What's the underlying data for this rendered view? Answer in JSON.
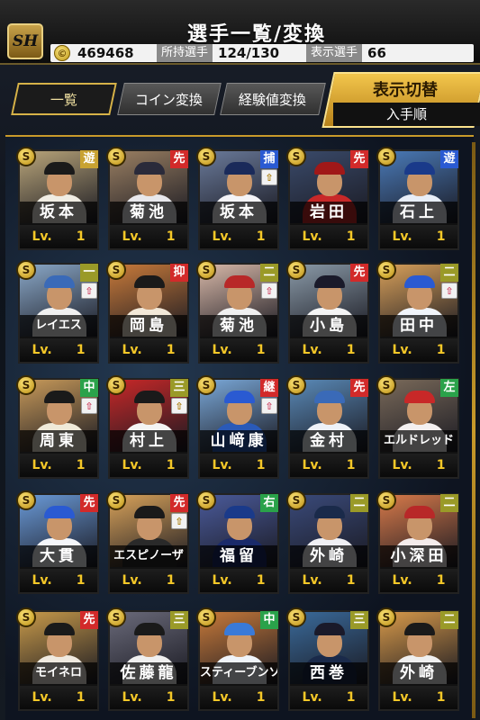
{
  "header": {
    "logo": "SH",
    "title": "選手一覧/変換",
    "coins": "469468",
    "owned_label": "所持選手",
    "owned_value": "124/130",
    "shown_label": "表示選手",
    "shown_value": "66"
  },
  "tabs": [
    {
      "label": "一覧"
    },
    {
      "label": "コイン変換"
    },
    {
      "label": "経験値変換"
    }
  ],
  "sort": {
    "title": "表示切替",
    "value": "入手順"
  },
  "level_label": "Lv.",
  "cards": [
    {
      "name": "坂本",
      "lv": "1",
      "pos": "遊",
      "pos_color": "gold",
      "up": false,
      "cap": "#1a1a1a",
      "uniform": "#f0ede4",
      "bg": "#b9a57a"
    },
    {
      "name": "菊池",
      "lv": "1",
      "pos": "先",
      "pos_color": "red",
      "up": false,
      "cap": "#2a2a3a",
      "uniform": "#e8e8ec",
      "bg": "#9a7f62"
    },
    {
      "name": "坂本",
      "lv": "1",
      "pos": "捕",
      "pos_color": "blue",
      "up": true,
      "cap": "#1a2a5a",
      "uniform": "#f4f4f8",
      "bg": "#6a7a9a"
    },
    {
      "name": "岩田",
      "lv": "1",
      "pos": "先",
      "pos_color": "red",
      "up": false,
      "cap": "#a01818",
      "uniform": "#c82828",
      "bg": "#3a4a6a"
    },
    {
      "name": "石上",
      "lv": "1",
      "pos": "遊",
      "pos_color": "blue",
      "up": false,
      "cap": "#1a3a8a",
      "uniform": "#e8eef8",
      "bg": "#4a7ab8"
    },
    {
      "name": "レイエス",
      "lv": "1",
      "pos": "一",
      "pos_color": "olive",
      "up": true,
      "up_pink": true,
      "cap": "#3a6ab8",
      "uniform": "#f0f0f0",
      "bg": "#8aa8c8",
      "tight": true
    },
    {
      "name": "岡島",
      "lv": "1",
      "pos": "抑",
      "pos_color": "red",
      "up": false,
      "cap": "#1a1a1a",
      "uniform": "#f2e8d8",
      "bg": "#c87a3a"
    },
    {
      "name": "菊池",
      "lv": "1",
      "pos": "二",
      "pos_color": "olive",
      "up": true,
      "up_pink": true,
      "cap": "#b82828",
      "uniform": "#f0f0f0",
      "bg": "#d8b8a8"
    },
    {
      "name": "小島",
      "lv": "1",
      "pos": "先",
      "pos_color": "red",
      "up": false,
      "cap": "#1a1a2a",
      "uniform": "#f4f4f4",
      "bg": "#8a9aa8"
    },
    {
      "name": "田中",
      "lv": "1",
      "pos": "二",
      "pos_color": "olive",
      "up": true,
      "up_pink": true,
      "cap": "#2a5ad2",
      "uniform": "#f0f4fa",
      "bg": "#d8a05a"
    },
    {
      "name": "周東",
      "lv": "1",
      "pos": "中",
      "pos_color": "green",
      "up": true,
      "up_pink": true,
      "cap": "#1a1a1a",
      "uniform": "#f0ead8",
      "bg": "#c89a5a"
    },
    {
      "name": "村上",
      "lv": "1",
      "pos": "三",
      "pos_color": "olive",
      "up": true,
      "cap": "#1a1a1a",
      "uniform": "#f4f4f4",
      "bg": "#c82828"
    },
    {
      "name": "山﨑康",
      "lv": "1",
      "pos": "継",
      "pos_color": "red",
      "up": true,
      "up_pink": true,
      "cap": "#2a5ad2",
      "uniform": "#2a5ab8",
      "bg": "#7aa8d8"
    },
    {
      "name": "金村",
      "lv": "1",
      "pos": "先",
      "pos_color": "red",
      "up": false,
      "cap": "#3a6ab8",
      "uniform": "#eef2f8",
      "bg": "#5a8ab8"
    },
    {
      "name": "エルドレッド",
      "lv": "1",
      "pos": "左",
      "pos_color": "green",
      "up": false,
      "cap": "#c82828",
      "uniform": "#f4f0f0",
      "bg": "#7a6a5a",
      "tight": true
    },
    {
      "name": "大貫",
      "lv": "1",
      "pos": "先",
      "pos_color": "red",
      "up": false,
      "cap": "#2a5ad2",
      "uniform": "#f4f6fa",
      "bg": "#6a9ad8"
    },
    {
      "name": "エスピノーザ",
      "lv": "1",
      "pos": "先",
      "pos_color": "red",
      "up": true,
      "cap": "#1a1a1a",
      "uniform": "#2a2a2a",
      "bg": "#d8a25a",
      "tight": true
    },
    {
      "name": "福留",
      "lv": "1",
      "pos": "右",
      "pos_color": "green",
      "up": false,
      "cap": "#1a3a8a",
      "uniform": "#1a2a6a",
      "bg": "#4a5a9a"
    },
    {
      "name": "外崎",
      "lv": "1",
      "pos": "二",
      "pos_color": "olive",
      "up": false,
      "cap": "#1a2a4a",
      "uniform": "#f0f0f4",
      "bg": "#3a4a7a"
    },
    {
      "name": "小深田",
      "lv": "1",
      "pos": "二",
      "pos_color": "olive",
      "up": false,
      "cap": "#b82828",
      "uniform": "#f4ecec",
      "bg": "#d87a4a"
    },
    {
      "name": "モイネロ",
      "lv": "1",
      "pos": "先",
      "pos_color": "red",
      "up": false,
      "cap": "#1a1a1a",
      "uniform": "#f0eae0",
      "bg": "#c89a4a",
      "tight": true
    },
    {
      "name": "佐藤龍",
      "lv": "1",
      "pos": "三",
      "pos_color": "olive",
      "up": false,
      "cap": "#1a1a1a",
      "uniform": "#f0f0f0",
      "bg": "#6a6a7a"
    },
    {
      "name": "スティーブンソン",
      "lv": "1",
      "pos": "中",
      "pos_color": "green",
      "up": false,
      "cap": "#3a7ad8",
      "uniform": "#f0f4fa",
      "bg": "#c87a3a",
      "tight": true
    },
    {
      "name": "西巻",
      "lv": "1",
      "pos": "三",
      "pos_color": "olive",
      "up": false,
      "cap": "#1a1a2a",
      "uniform": "#1a2a4a",
      "bg": "#3a6a9a"
    },
    {
      "name": "外崎",
      "lv": "1",
      "pos": "二",
      "pos_color": "olive",
      "up": false,
      "cap": "#1a1a1a",
      "uniform": "#f0f0f0",
      "bg": "#d89a4a"
    }
  ]
}
